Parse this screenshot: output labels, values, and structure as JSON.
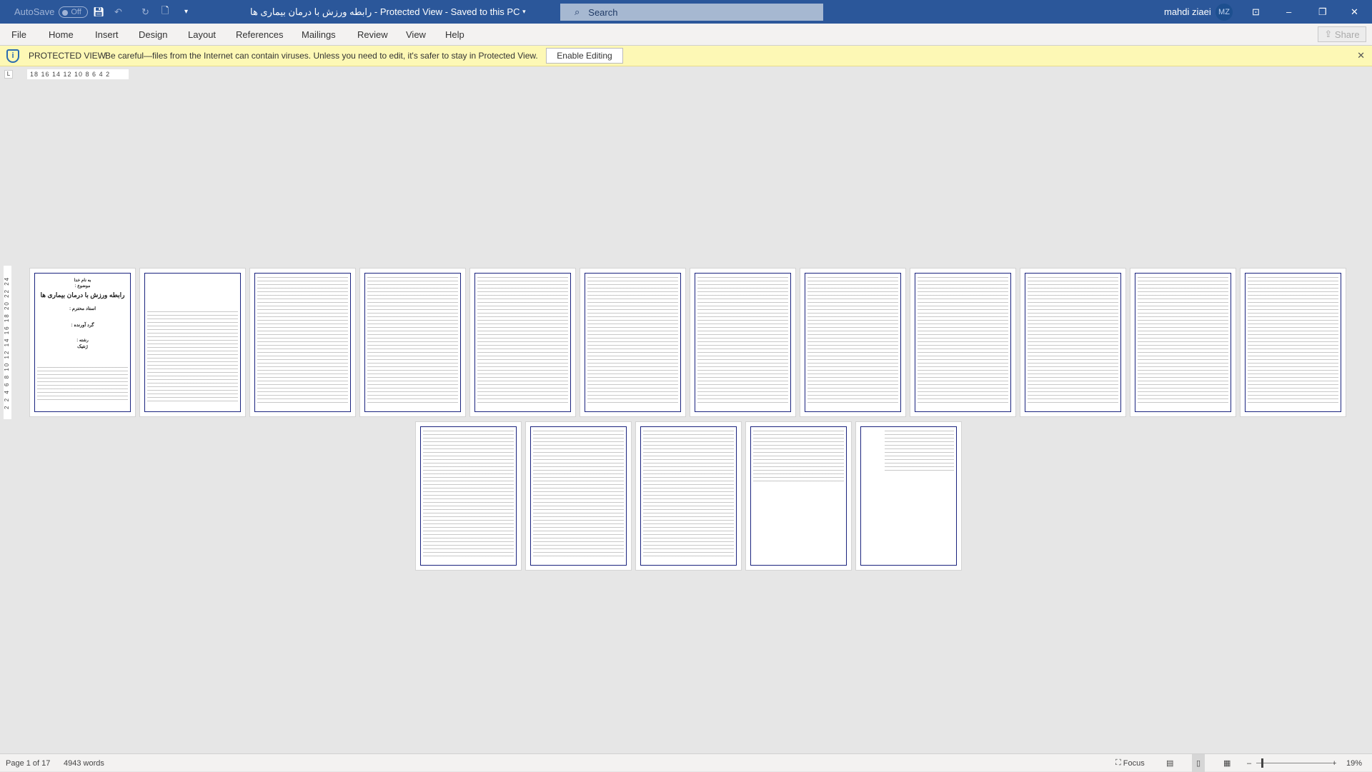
{
  "titlebar": {
    "autosave_label": "AutoSave",
    "autosave_state": "Off",
    "document_title": "رابطه ورزش با درمان بیماری ها",
    "view_state": "Protected View",
    "save_state": "Saved to this PC",
    "search_placeholder": "Search",
    "user_name": "mahdi ziaei",
    "user_initials": "MZ"
  },
  "ribbon": {
    "tabs": [
      "File",
      "Home",
      "Insert",
      "Design",
      "Layout",
      "References",
      "Mailings",
      "Review",
      "View",
      "Help"
    ],
    "share_label": "Share"
  },
  "protected_view": {
    "title": "PROTECTED VIEW",
    "message": "Be careful—files from the Internet can contain viruses. Unless you need to edit, it's safer to stay in Protected View.",
    "button_label": "Enable Editing"
  },
  "ruler": {
    "horizontal": "18 16 14 12 10 8 6 4 2",
    "vertical": "2 2 4 6 8 10 12 14 16 18 20 22 24"
  },
  "cover_page": {
    "line1": "به نام خدا",
    "line2": "موضوع :",
    "title": "رابطه ورزش با درمان بیماری ها",
    "teacher": "استاد محترم :",
    "author": "گرد آورنده :",
    "field_label": "رشته :",
    "field_value": "ژنتیک"
  },
  "document": {
    "page_count": 17
  },
  "statusbar": {
    "page_info": "Page 1 of 17",
    "word_count": "4943 words",
    "focus_label": "Focus",
    "zoom_level": "19%"
  },
  "colors": {
    "titlebar": "#2b579a",
    "protected_bar": "#fdf8b5",
    "page_border": "#1a237e"
  }
}
